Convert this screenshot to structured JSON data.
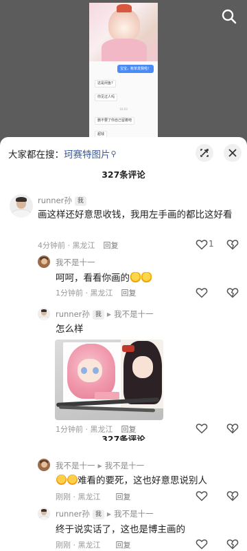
{
  "video": {
    "chat": {
      "right_msg": "宝宝，帐单发我啦！",
      "left_msgs": [
        "这是闲鱼?",
        "你见过人吗",
        "删不要了你自己留着吧",
        "超钱"
      ],
      "time": "16:03"
    }
  },
  "header": {
    "hot_prefix": "大家都在搜：",
    "hot_query": "珂赛特图片",
    "comment_count": "327条评论"
  },
  "comments": [
    {
      "user": "runner孙",
      "badge": "我",
      "text": "画这样还好意思收钱，我用左手画的都比这好看",
      "meta": "4分钟前 · 黑龙江",
      "reply": "回复",
      "likes": "1"
    },
    {
      "user": "我不是十一",
      "text": "呵呵，看看你画的",
      "meta": "1分钟前 · 黑龙江",
      "reply": "回复"
    },
    {
      "user": "runner孙",
      "badge": "我",
      "reply_to": "我不是十一",
      "text": "怎么样",
      "meta": "1分钟前 · 黑龙江",
      "reply": "回复"
    },
    {
      "user": "我不是十一",
      "reply_to": "我不是十一",
      "text": "难看的要死，这也好意思说别人",
      "meta": "刚刚 · 黑龙江",
      "reply": "回复"
    },
    {
      "user": "runner孙",
      "badge": "我",
      "reply_to": "我不是十一",
      "text": "终于说实话了，这也是博主画的",
      "meta": "刚刚 · 黑龙江",
      "reply": "回复"
    }
  ],
  "overlay_count": "327条评论",
  "colors": {
    "link": "#3b5998",
    "sheet_bg": "#ffffff",
    "dim_bg": "#5a5a5a"
  }
}
